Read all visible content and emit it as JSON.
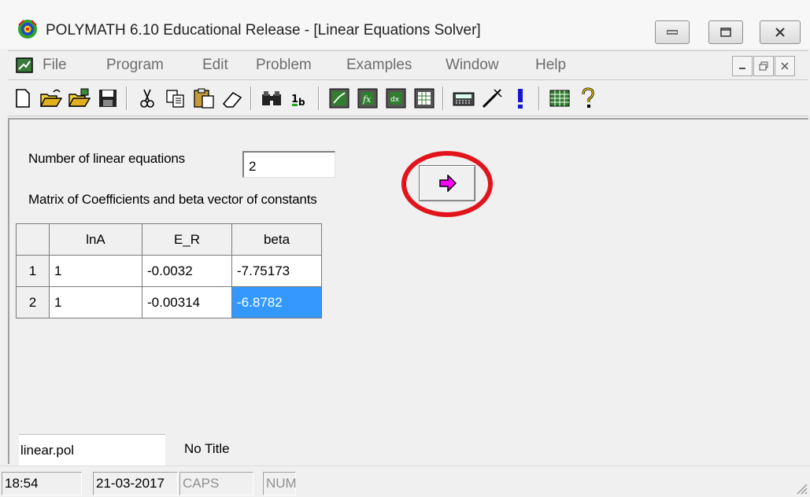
{
  "window": {
    "title": "POLYMATH 6.10 Educational Release - [Linear Equations Solver]"
  },
  "menu": {
    "items": [
      "File",
      "Program",
      "Edit",
      "Problem",
      "Examples",
      "Window",
      "Help"
    ]
  },
  "toolbar": {
    "icons": [
      "new-file-icon",
      "open-folder-icon",
      "open-folder-alt-icon",
      "save-icon",
      "cut-icon",
      "copy-icon",
      "paste-icon",
      "eraser-icon",
      "find-icon",
      "unit-icon",
      "graph-icon",
      "function-icon",
      "derivative-icon",
      "table-icon",
      "calculator-icon",
      "wand-icon",
      "run-icon",
      "spreadsheet-icon",
      "help-icon"
    ]
  },
  "form": {
    "num_equations_label": "Number of linear equations",
    "num_equations_value": "2",
    "matrix_label": "Matrix of Coefficients and beta vector of constants"
  },
  "grid": {
    "columns": [
      "lnA",
      "E_R",
      "beta"
    ],
    "rows": [
      {
        "index": "1",
        "cells": [
          "1",
          "-0.0032",
          "-7.75173"
        ]
      },
      {
        "index": "2",
        "cells": [
          "1",
          "-0.00314",
          "-6.8782"
        ]
      }
    ],
    "selected_cell": "row 2, beta"
  },
  "footer": {
    "filename": "linear.pol",
    "problem_title": "No Title"
  },
  "statusbar": {
    "time": "18:54",
    "date": "21-03-2017",
    "caps": "CAPS",
    "num": "NUM"
  },
  "colors": {
    "highlight_ring": "#e3131b",
    "arrow": "#ff00ff",
    "selection": "#3399ff"
  }
}
